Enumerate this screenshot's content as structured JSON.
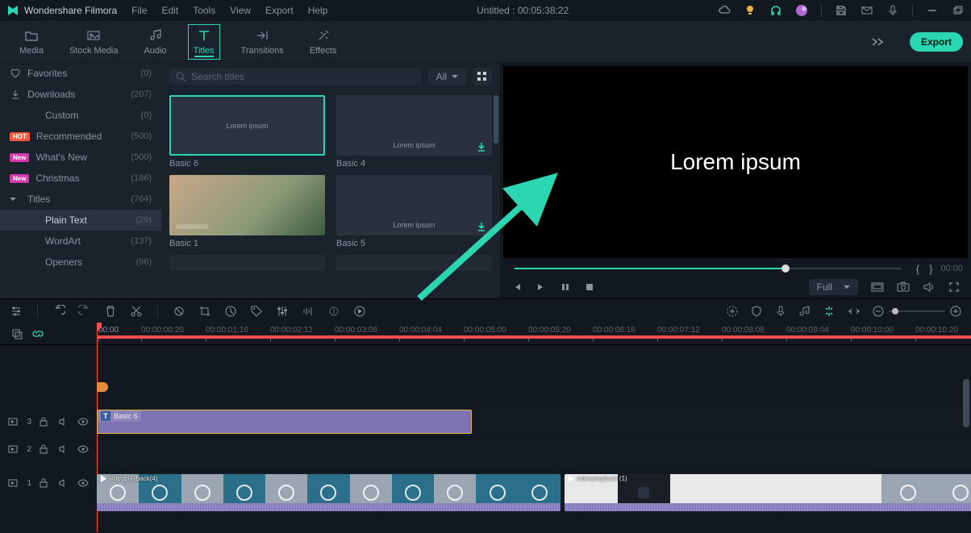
{
  "app": {
    "name": "Wondershare Filmora",
    "doc_title": "Untitled : 00:05:38:22"
  },
  "menu": {
    "file": "File",
    "edit": "Edit",
    "tools": "Tools",
    "view": "View",
    "export": "Export",
    "help": "Help"
  },
  "modules": {
    "media": "Media",
    "stock": "Stock Media",
    "audio": "Audio",
    "titles": "Titles",
    "transitions": "Transitions",
    "effects": "Effects",
    "export_btn": "Export"
  },
  "sidebar": {
    "items": [
      {
        "icon": "heart",
        "label": "Favorites",
        "count": "(0)"
      },
      {
        "icon": "download",
        "label": "Downloads",
        "count": "(207)"
      },
      {
        "icon": "none",
        "label": "Custom",
        "count": "(0)",
        "indent": true
      },
      {
        "badge": "HOT",
        "label": "Recommended",
        "count": "(500)"
      },
      {
        "badge": "New",
        "label": "What's New",
        "count": "(500)"
      },
      {
        "badge": "New",
        "label": "Christmas",
        "count": "(186)"
      },
      {
        "icon": "chevd",
        "label": "Titles",
        "count": "(764)"
      },
      {
        "icon": "none",
        "label": "Plain Text",
        "count": "(29)",
        "indent": true,
        "selected": true
      },
      {
        "icon": "none",
        "label": "WordArt",
        "count": "(137)",
        "indent": true
      },
      {
        "icon": "none",
        "label": "Openers",
        "count": "(96)",
        "indent": true
      }
    ]
  },
  "browser": {
    "search_placeholder": "Search titles",
    "filter": "All",
    "items": [
      {
        "name": "Basic 6",
        "preview_text": "Lorem ipsum",
        "selected": true,
        "download": false,
        "kind": "black"
      },
      {
        "name": "Basic 4",
        "preview_text": "Lorem ipsum",
        "selected": false,
        "download": true,
        "kind": "dark"
      },
      {
        "name": "Basic 1",
        "preview_text": "",
        "selected": false,
        "download": false,
        "kind": "video"
      },
      {
        "name": "Basic 5",
        "preview_text": "Lorem ipsum",
        "selected": false,
        "download": true,
        "kind": "dark"
      }
    ]
  },
  "preview": {
    "text": "Lorem ipsum",
    "progress": 0.7,
    "time_current": "{       }",
    "time_total": "00:00",
    "resolution": "Full"
  },
  "toolbar": {},
  "timeline": {
    "ruler_start": "00:00",
    "ticks": [
      "00:00:00:20",
      "00:00:01:16",
      "00:00:02:12",
      "00:00:03:08",
      "00:00:04:04",
      "00:00:05:00",
      "00:00:05:20",
      "00:00:06:16",
      "00:00:07:12",
      "00:00:08:08",
      "00:00:09:04",
      "00:00:10:00",
      "00:00:10:20"
    ],
    "tracks": {
      "t3": {
        "label": "3"
      },
      "t2": {
        "label": "2"
      },
      "t1": {
        "label": "1"
      }
    },
    "title_clip": {
      "name": "Basic 6"
    },
    "video_clip_a": {
      "name": "videoplayback(4)"
    },
    "video_clip_b": {
      "name": "videoplayback (1)"
    }
  }
}
